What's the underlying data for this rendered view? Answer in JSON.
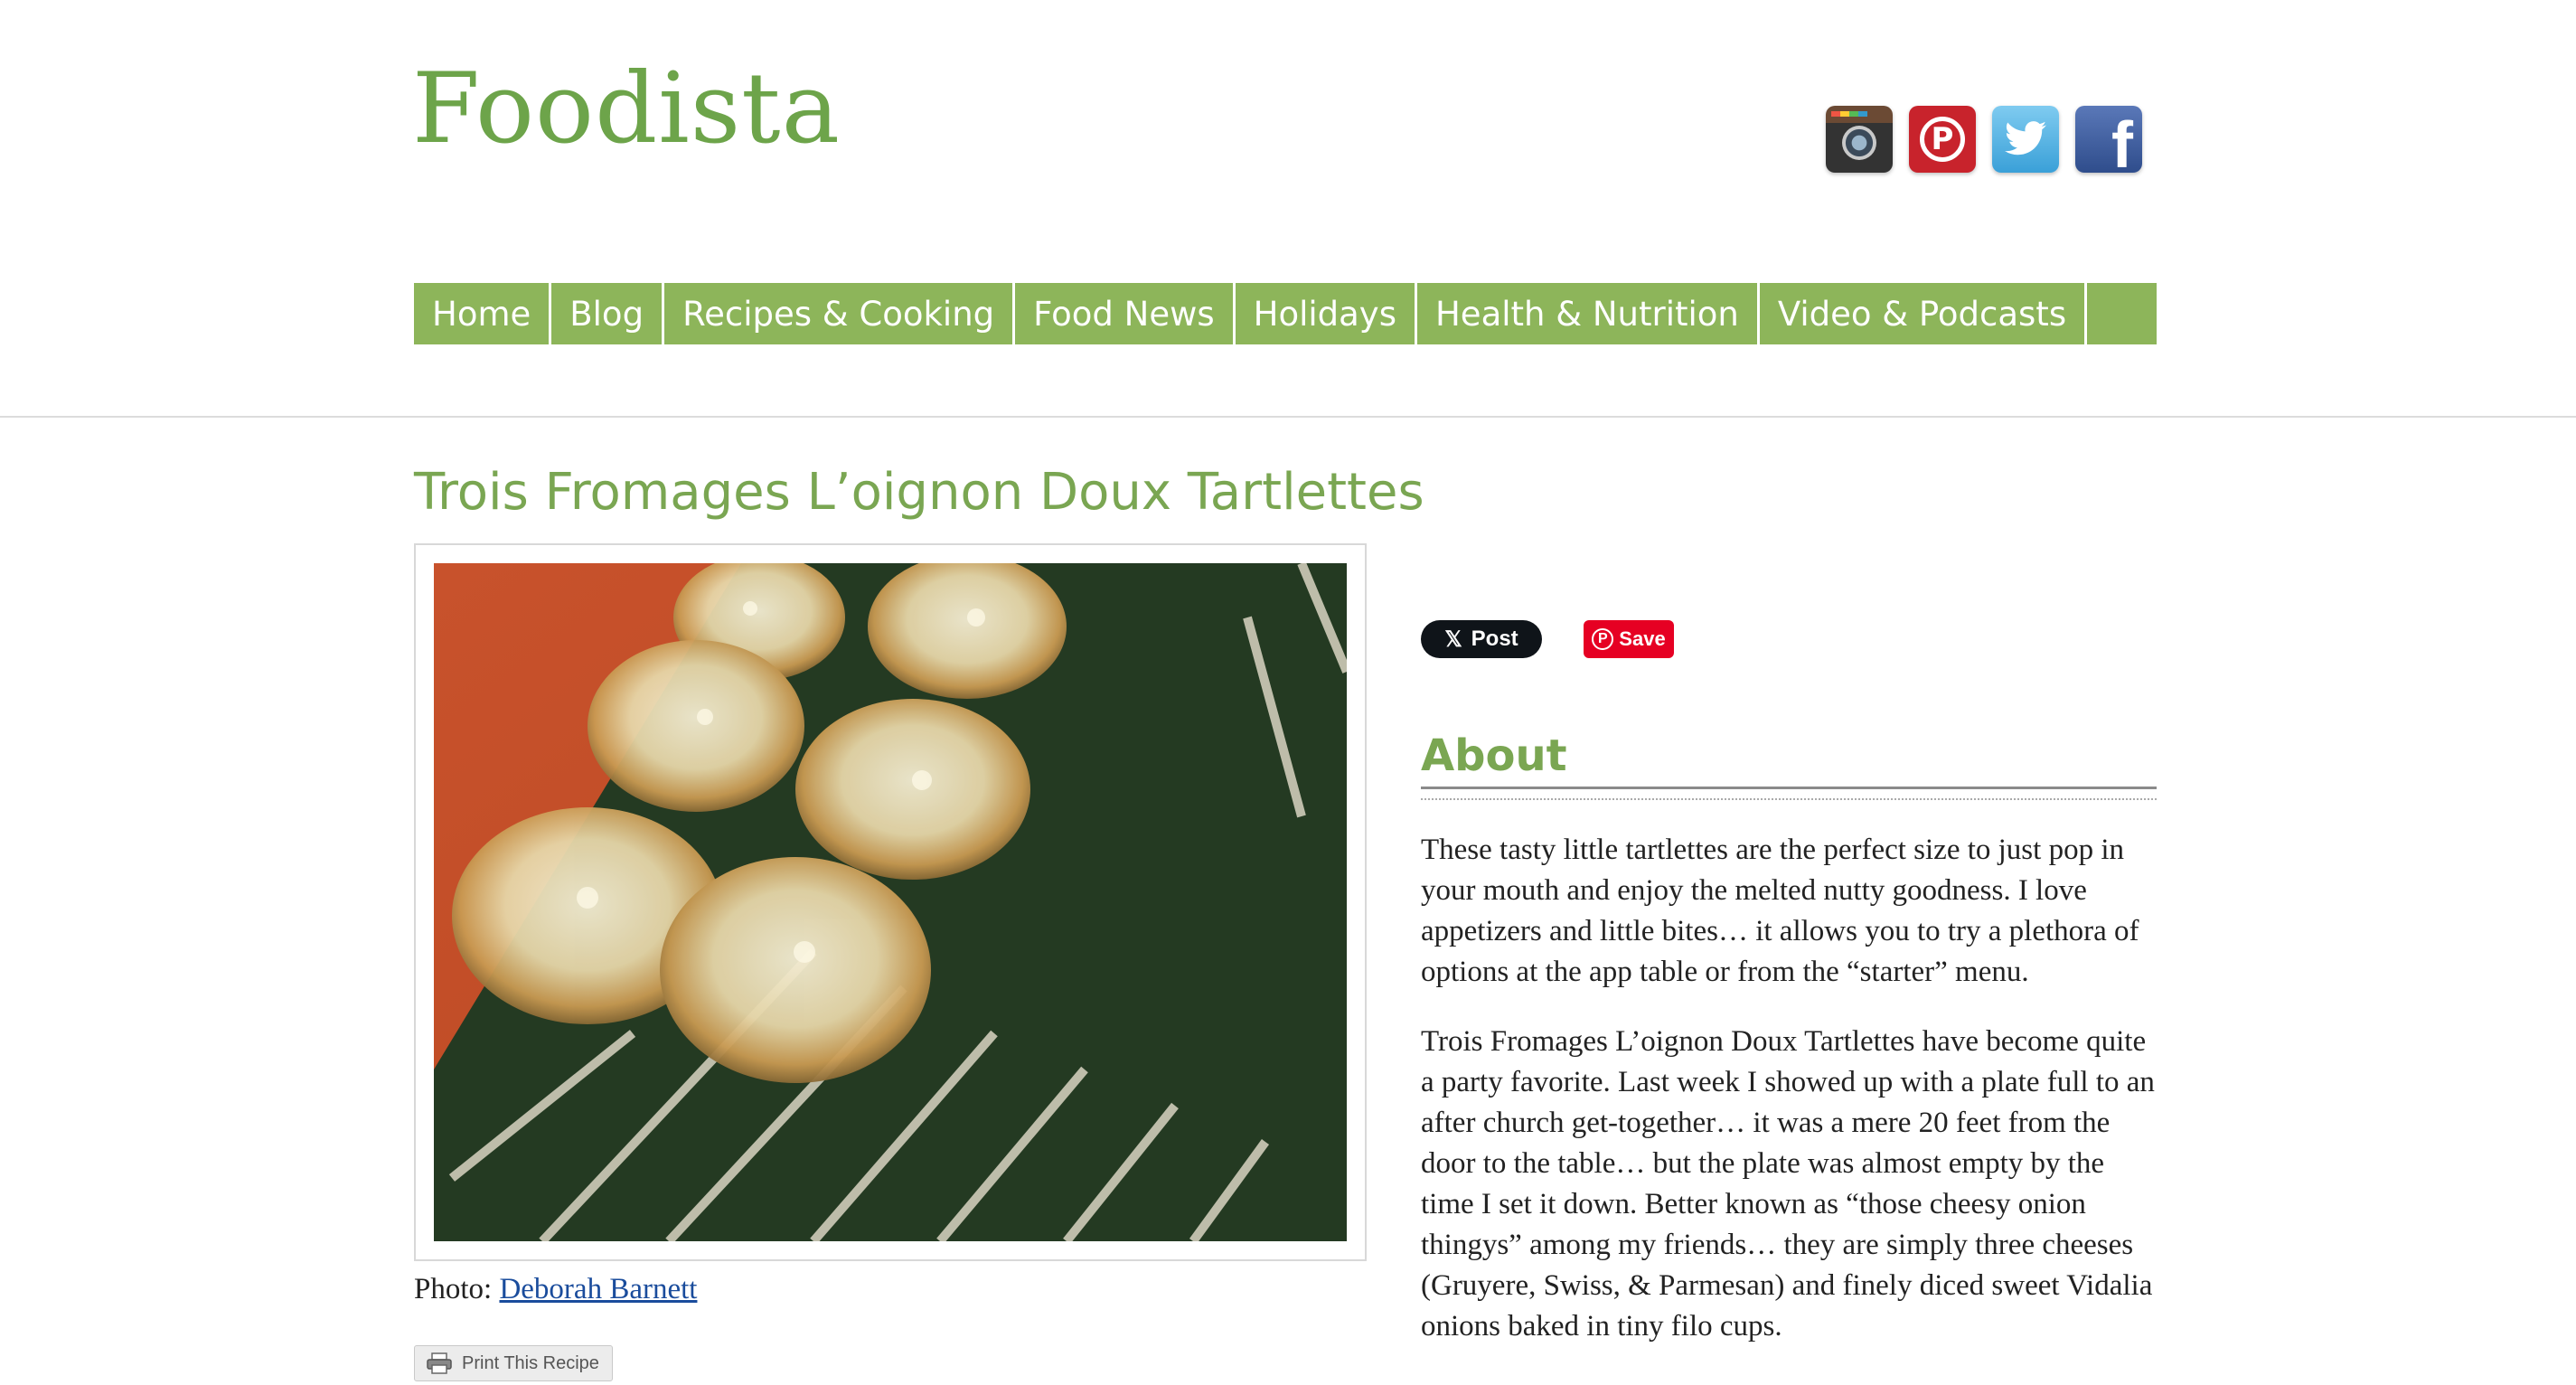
{
  "site": {
    "logo_text": "Foodista"
  },
  "social": [
    {
      "name": "instagram-icon"
    },
    {
      "name": "pinterest-icon"
    },
    {
      "name": "twitter-icon"
    },
    {
      "name": "facebook-icon"
    }
  ],
  "nav": {
    "items": [
      {
        "label": "Home"
      },
      {
        "label": "Blog"
      },
      {
        "label": "Recipes & Cooking"
      },
      {
        "label": "Food News"
      },
      {
        "label": "Holidays"
      },
      {
        "label": "Health & Nutrition"
      },
      {
        "label": "Video & Podcasts"
      }
    ]
  },
  "recipe": {
    "title": "Trois Fromages L’oignon Doux Tartlettes",
    "photo_prefix": "Photo:",
    "photo_author": "Deborah Barnett",
    "print_label": "Print This Recipe"
  },
  "share": {
    "x_label": "Post",
    "pin_label": "Save"
  },
  "about": {
    "heading": "About",
    "paragraphs": [
      "These tasty little tartlettes are the perfect size to just pop in your mouth and enjoy the melted nutty goodness. I love appetizers and little bites… it allows you to try a plethora of options at the app table or from the “starter” menu.",
      "Trois Fromages L’oignon Doux Tartlettes have become quite a party favorite. Last week I showed up with a plate full to an after church get-together… it was a mere 20 feet from the door to the table… but the plate was almost empty by the time I set it down. Better known as “those cheesy onion thingys” among my friends… they are simply three cheeses (Gruyere, Swiss, & Parmesan) and finely diced sweet Vidalia onions baked in tiny filo cups."
    ]
  },
  "colors": {
    "brand_green": "#8db55a",
    "title_green": "#7aa652",
    "logo_red": "#d9534f",
    "link_blue": "#1a4c9c"
  }
}
